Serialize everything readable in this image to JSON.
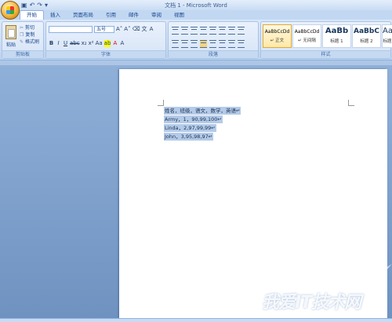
{
  "window": {
    "title": "文档 1 - Microsoft Word"
  },
  "tabs": [
    {
      "label": "开始",
      "active": true
    },
    {
      "label": "插入",
      "active": false
    },
    {
      "label": "页面布局",
      "active": false
    },
    {
      "label": "引用",
      "active": false
    },
    {
      "label": "邮件",
      "active": false
    },
    {
      "label": "审阅",
      "active": false
    },
    {
      "label": "视图",
      "active": false
    }
  ],
  "clipboard": {
    "paste_label": "粘贴",
    "cut_label": "剪切",
    "copy_label": "复制",
    "format_painter_label": "格式刷",
    "group_label": "剪贴板"
  },
  "font": {
    "font_name_value": "",
    "font_size_value": "五号",
    "group_label": "字体"
  },
  "paragraph": {
    "group_label": "段落"
  },
  "styles": {
    "items": [
      {
        "sample": "AaBbCcDd",
        "name": "↵ 正文"
      },
      {
        "sample": "AaBbCcDd",
        "name": "↵ 无间隔"
      },
      {
        "sample": "AaBb",
        "name": "标题 1"
      },
      {
        "sample": "AaBbC",
        "name": "标题 2"
      },
      {
        "sample": "AaBb",
        "name": "标题"
      }
    ],
    "group_label": "样式"
  },
  "document": {
    "lines": [
      "姓名，班级，语文，数学，英语↵",
      "Army，1，90,99,100↵",
      "Linda，2,97,99,99↵",
      "John，3,95,98,97↵"
    ]
  },
  "watermark": {
    "text": "我爱IT技术网"
  },
  "colors": {
    "ribbon_bg": "#dbe7f7",
    "selection": "#b4cbe8",
    "workspace": "#8fb0d8"
  }
}
